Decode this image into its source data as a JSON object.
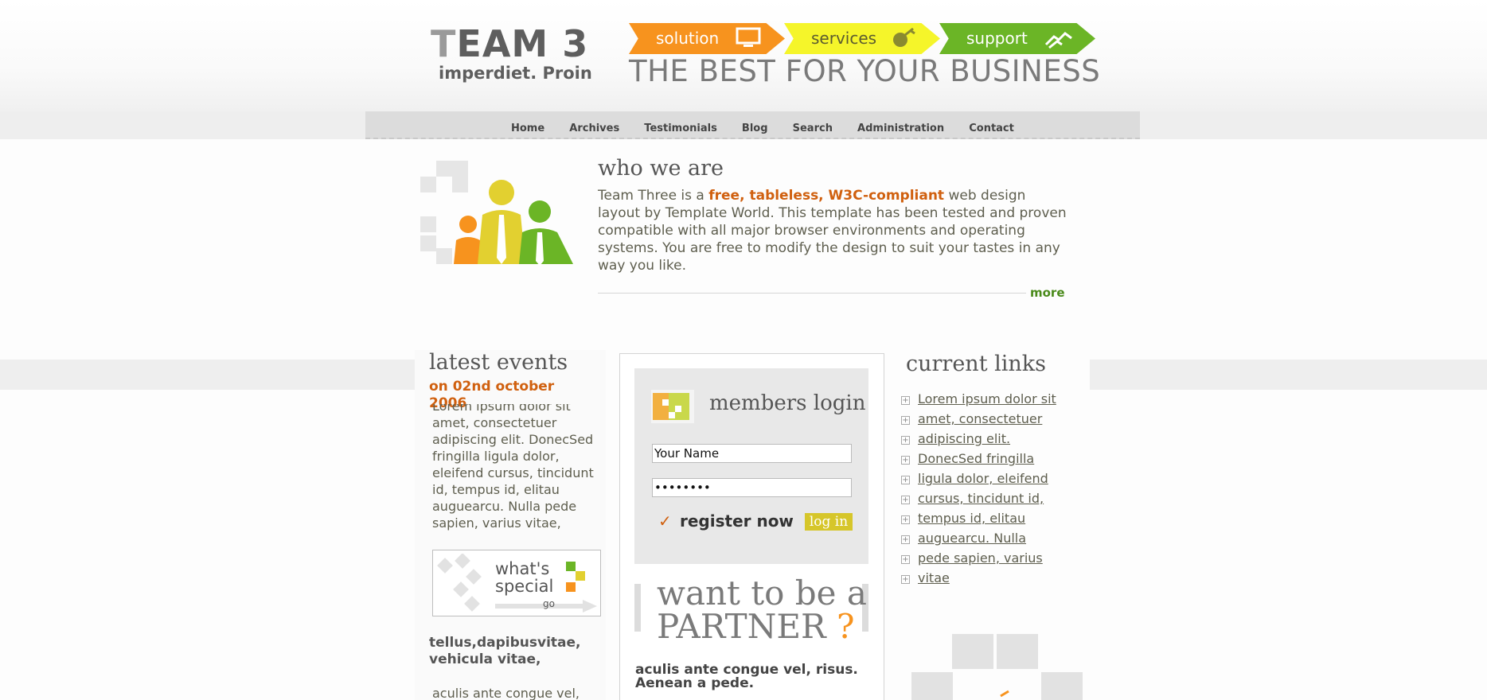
{
  "header": {
    "logo_first": "T",
    "logo_rest": "EAM 3",
    "logo_sub": "imperdiet. Proin",
    "tabs": [
      "solution",
      "services",
      "support"
    ],
    "slogan": "THE BEST FOR YOUR BUSINESS"
  },
  "nav": [
    "Home",
    "Archives",
    "Testimonials",
    "Blog",
    "Search",
    "Administration",
    "Contact"
  ],
  "who": {
    "title": "who we are",
    "text_before": "Team Three is a ",
    "highlight": "free, tableless, W3C-compliant",
    "text_after": " web design layout by Template World. This template has been tested and proven compatible with all major browser environments and operating systems. You are free to modify the design to suit your tastes in any way you like.",
    "more": "more"
  },
  "events": {
    "title": "latest events",
    "date": "on 02nd october 2006",
    "text": "Lorem ipsum dolor sit amet, consectetuer adipiscing elit. DonecSed fringilla ligula dolor, eleifend cursus, tincidunt id, tempus id, elitau auguearcu. Nulla pede sapien, varius vitae,",
    "special_line1": "what's",
    "special_line2": "special",
    "special_go": "go",
    "sub_title": "tellus,dapibusvitae, vehicula vitae,",
    "sub_text": "aculis ante congue vel,"
  },
  "login": {
    "title": "members login",
    "name_value": "Your Name",
    "password_value": "••••••••",
    "check": "✓",
    "register": "register now",
    "button": "log in"
  },
  "partner": {
    "line1": "want to be a",
    "line2": "PARTNER",
    "mark": "?"
  },
  "middle_sub": "aculis ante congue vel, risus. Aenean a pede.",
  "links": {
    "title": "current links",
    "items": [
      "Lorem ipsum dolor sit",
      "amet, consectetuer",
      "adipiscing elit.",
      "DonecSed fringilla",
      "ligula dolor, eleifend",
      "cursus, tincidunt id,",
      "tempus id, elitau",
      "auguearcu. Nulla",
      "pede sapien, varius",
      "vitae"
    ]
  },
  "colors": {
    "orange": "#f7931e",
    "yellow": "#f5f52a",
    "green": "#6bb526",
    "accent_text": "#d0600f"
  }
}
